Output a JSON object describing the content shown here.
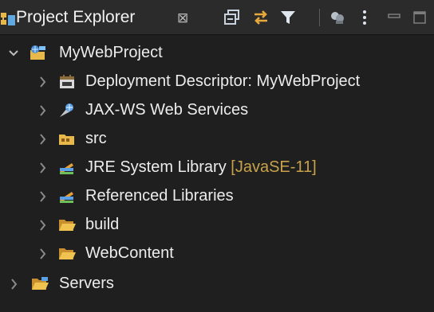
{
  "view": {
    "title": "Project Explorer",
    "close_glyph": "⊠"
  },
  "toolbar": [
    {
      "name": "collapse-all-icon"
    },
    {
      "name": "link-with-editor-icon"
    },
    {
      "name": "filter-icon"
    },
    {
      "name": "focus-on-active-task-icon"
    },
    {
      "name": "view-menu-icon"
    },
    {
      "name": "minimize-icon"
    },
    {
      "name": "maximize-icon"
    }
  ],
  "tree": {
    "project": {
      "label": "MyWebProject",
      "expanded": true
    },
    "children": [
      {
        "label": "Deployment Descriptor: MyWebProject"
      },
      {
        "label": "JAX-WS Web Services"
      },
      {
        "label": "src"
      },
      {
        "label": "JRE System Library",
        "decoration": "[JavaSE-11]"
      },
      {
        "label": "Referenced Libraries"
      },
      {
        "label": "build"
      },
      {
        "label": "WebContent"
      }
    ],
    "servers": {
      "label": "Servers"
    }
  },
  "colors": {
    "background": "#1f1f1f",
    "header": "#2b2b2b",
    "text": "#ececec",
    "decoration": "#c8a24a",
    "folder": "#e9b84a"
  }
}
